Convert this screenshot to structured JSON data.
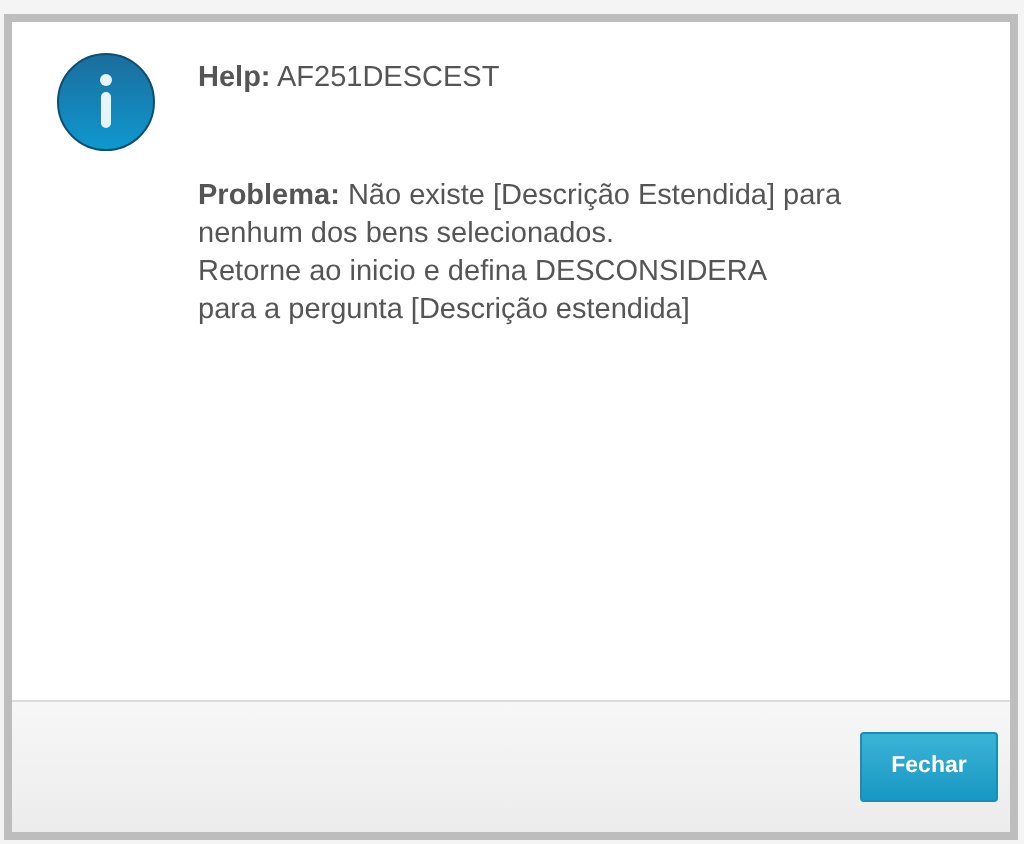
{
  "dialog": {
    "help_label": "Help:",
    "help_code": "AF251DESCEST",
    "message": "**Problema:** Não existe [Descrição Estendida] para\nnenhum dos bens selecionados.\nRetorne ao inicio e defina DESCONSIDERA\npara a pergunta [Descrição estendida]",
    "buttons": [
      "Fechar"
    ]
  }
}
